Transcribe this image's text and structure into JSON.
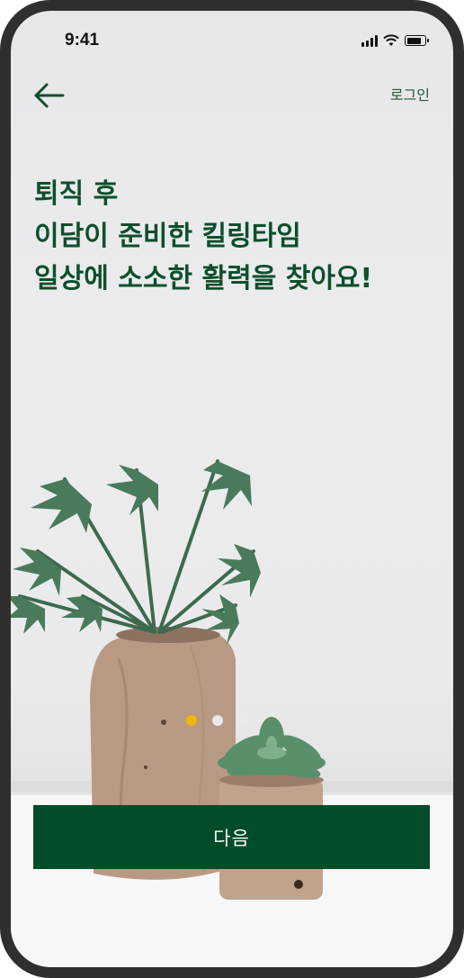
{
  "status_bar": {
    "time": "9:41",
    "icons": [
      "signal-icon",
      "wifi-icon",
      "battery-icon"
    ]
  },
  "nav": {
    "back_icon": "arrow-left-icon",
    "login_label": "로그인"
  },
  "headline": {
    "lines": [
      "퇴직 후",
      "이담이 준비한 킬링타임",
      "일상에 소소한 활력을 찾아요!"
    ]
  },
  "pager": {
    "total": 3,
    "current": 1
  },
  "cta": {
    "next_label": "다음"
  },
  "colors": {
    "brand_green": "#024d27",
    "headline_green": "#0d4f2b",
    "pager_active": "#f2b705",
    "frame": "#2f2f2f"
  }
}
